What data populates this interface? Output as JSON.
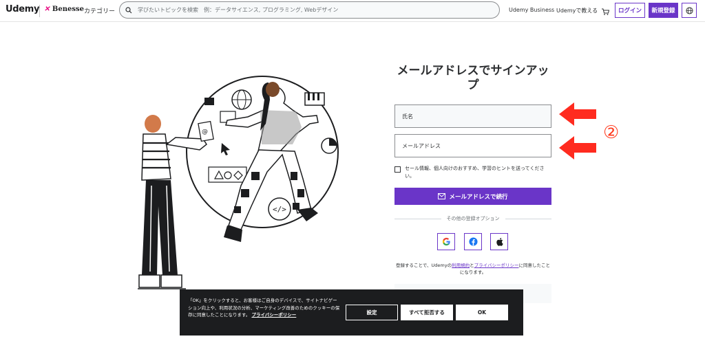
{
  "header": {
    "logo_text": "Udemy",
    "partner_text": "Benesse",
    "category_label": "カテゴリー",
    "search_placeholder": "学びたいトピックを検索　例：データサイエンス, プログラミング, Webデザイン",
    "business_link": "Udemy Business",
    "teach_link": "Udemyで教える",
    "login_label": "ログイン",
    "signup_label": "新規登録"
  },
  "form": {
    "title": "メールアドレスでサインアップ",
    "name_field": "氏名",
    "email_field": "メールアドレス",
    "checkbox_label": "セール情報、個人向けのおすすめ、学習のヒントを送ってください。",
    "continue_label": "メールアドレスで続行",
    "other_options_label": "その他の登録オプション",
    "terms_prefix": "登録することで、Udemyの",
    "terms_link": "利用規約",
    "terms_mid": "と",
    "privacy_link": "プライバシーポリシー",
    "terms_suffix": "に同意したことになります。"
  },
  "annotation": {
    "step_number": "②",
    "arrow_color": "#ff2b1f"
  },
  "cookie": {
    "text": "「OK」をクリックすると、お客様はご自身のデバイスで、サイトナビゲーション向上や、利用状況の分析、マーケティング改善のためのクッキーの保存に同意したことになります。",
    "privacy_link": "プライバシーポリシー",
    "settings_label": "設定",
    "reject_label": "すべて拒否する",
    "ok_label": "OK"
  },
  "colors": {
    "brand_purple": "#6a35c8",
    "dark": "#1c1d1f"
  }
}
